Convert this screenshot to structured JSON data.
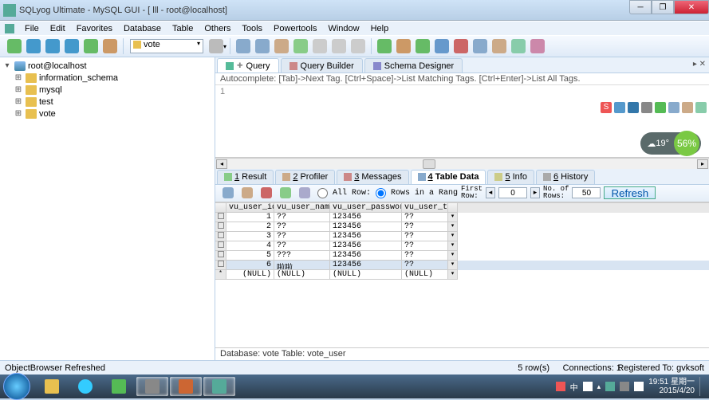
{
  "window": {
    "title": "SQLyog Ultimate - MySQL GUI - [ lll - root@localhost]"
  },
  "menu": [
    "File",
    "Edit",
    "Favorites",
    "Database",
    "Table",
    "Others",
    "Tools",
    "Powertools",
    "Window",
    "Help"
  ],
  "db_selector": "vote",
  "tree": {
    "root": "root@localhost",
    "dbs": [
      "information_schema",
      "mysql",
      "test",
      "vote"
    ]
  },
  "top_tabs": [
    {
      "label": "Query",
      "active": true
    },
    {
      "label": "Query Builder",
      "active": false
    },
    {
      "label": "Schema Designer",
      "active": false
    }
  ],
  "hint_text": "Autocomplete: [Tab]->Next Tag. [Ctrl+Space]->List Matching Tags. [Ctrl+Enter]->List All Tags.",
  "sql_text": "1",
  "lower_tabs": [
    {
      "n": "1",
      "label": "Result"
    },
    {
      "n": "2",
      "label": "Profiler"
    },
    {
      "n": "3",
      "label": "Messages"
    },
    {
      "n": "4",
      "label": "Table Data"
    },
    {
      "n": "5",
      "label": "Info"
    },
    {
      "n": "6",
      "label": "History"
    }
  ],
  "data_toolbar": {
    "all_row": "All Row:",
    "rows_range": "Rows in a Rang",
    "first_row": "First\nRow:",
    "first_row_val": "0",
    "no_rows": "No. of\nRows:",
    "no_rows_val": "50",
    "refresh": "Refresh"
  },
  "grid": {
    "columns": [
      "vu_user_id",
      "vu_user_name",
      "vu_user_password",
      "vu_user_type"
    ],
    "rows": [
      {
        "id": "1",
        "name": "??",
        "pwd": "123456",
        "type": "??",
        "sel": false
      },
      {
        "id": "2",
        "name": "??",
        "pwd": "123456",
        "type": "??",
        "sel": false
      },
      {
        "id": "3",
        "name": "??",
        "pwd": "123456",
        "type": "??",
        "sel": false
      },
      {
        "id": "4",
        "name": "??",
        "pwd": "123456",
        "type": "??",
        "sel": false
      },
      {
        "id": "5",
        "name": "???",
        "pwd": "123456",
        "type": "??",
        "sel": false
      },
      {
        "id": "6",
        "name": "啦啦",
        "pwd": "123456",
        "type": "??",
        "sel": true
      }
    ],
    "null_row": {
      "id": "(NULL)",
      "name": "(NULL)",
      "pwd": "(NULL)",
      "type": "(NULL)"
    }
  },
  "db_status": "Database: vote Table: vote_user",
  "app_status": {
    "left": "ObjectBrowser Refreshed",
    "rows": "5 row(s)",
    "conn": "Connections: 1",
    "reg": "Registered To: gvksoft"
  },
  "clock": {
    "time": "19:51",
    "day": "星期一",
    "date": "2015/4/20"
  },
  "weather": {
    "temp": "19°",
    "pct": "56%"
  },
  "side_widget_s": "S",
  "tray_flag": "中"
}
